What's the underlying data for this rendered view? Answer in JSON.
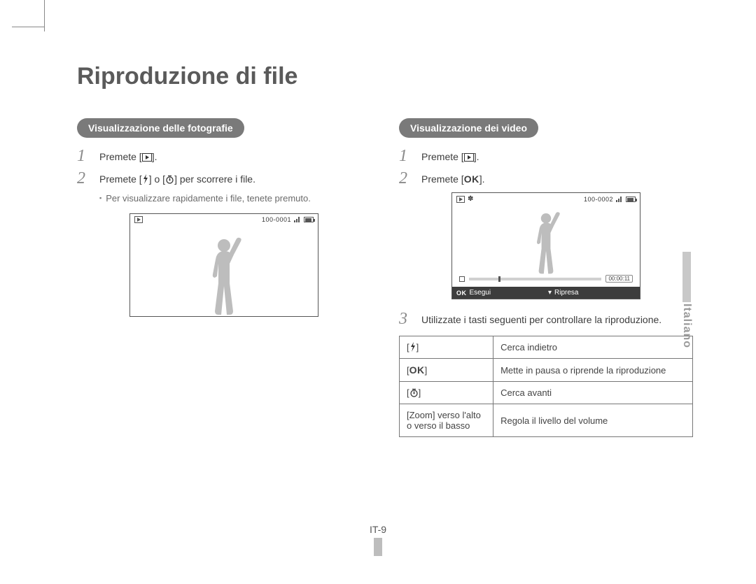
{
  "title": "Riproduzione di file",
  "left": {
    "pill": "Visualizzazione delle fotografie",
    "step1": "Premete [",
    "step1_end": "].",
    "step2_a": "Premete [",
    "step2_b": "] o [",
    "step2_c": "] per scorrere i file.",
    "sub": "Per visualizzare rapidamente i file, tenete premuto.",
    "screen_counter": "100-0001"
  },
  "right": {
    "pill": "Visualizzazione dei video",
    "step1": "Premete [",
    "step1_end": "].",
    "step2": "Premete [",
    "step2_end": "].",
    "step3": "Utilizzate i tasti seguenti per controllare la riproduzione.",
    "screen_counter": "100-0002",
    "screen_time": "00:00:11",
    "screen_exec": "Esegui",
    "screen_rec": "Ripresa",
    "table": {
      "r1c2": "Cerca indietro",
      "r2c2": "Mette in pausa o riprende la riproduzione",
      "r3c2": "Cerca avanti",
      "r4c1": "[Zoom] verso l'alto o verso il basso",
      "r4c2": "Regola il livello del volume"
    }
  },
  "lang": "Italiano",
  "page_number": "IT-9",
  "ok_label": "OK"
}
